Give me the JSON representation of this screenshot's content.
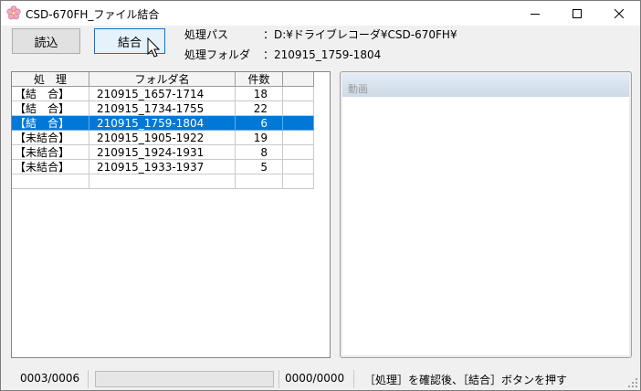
{
  "window": {
    "title": "CSD-670FH_ファイル結合",
    "controls": {
      "minimize": "minimize",
      "maximize": "maximize",
      "close": "close"
    }
  },
  "toolbar": {
    "load_label": "読込",
    "merge_label": "結合"
  },
  "info": {
    "path_label": "処理パス",
    "path_value": "：D:¥ドライブレコーダ¥CSD-670FH¥",
    "folder_label": "処理フォルダ",
    "folder_value": "：210915_1759-1804"
  },
  "list": {
    "columns": [
      "処　理",
      "フォルダ名",
      "件数"
    ],
    "rows": [
      {
        "status": "【結　合】",
        "folder": "210915_1657-1714",
        "count": "18"
      },
      {
        "status": "【結　合】",
        "folder": "210915_1734-1755",
        "count": "22"
      },
      {
        "status": "【結　合】",
        "folder": "210915_1759-1804",
        "count": "6"
      },
      {
        "status": "【未結合】",
        "folder": "210915_1905-1922",
        "count": "19"
      },
      {
        "status": "【未結合】",
        "folder": "210915_1924-1931",
        "count": "8"
      },
      {
        "status": "【未結合】",
        "folder": "210915_1933-1937",
        "count": "5"
      }
    ],
    "selected_row_index": 2
  },
  "video": {
    "label": "動画"
  },
  "status": {
    "file_counter": "0003/0006",
    "progress": 0,
    "time_counter": "0000/0000",
    "message": "［処理］を確認後、［結合］ボタンを押す"
  },
  "colors": {
    "selection": "#0078d7",
    "button_hover": "#e5f1fb",
    "titlebar": "#ffffff",
    "window_bg": "#f0f0f0"
  }
}
